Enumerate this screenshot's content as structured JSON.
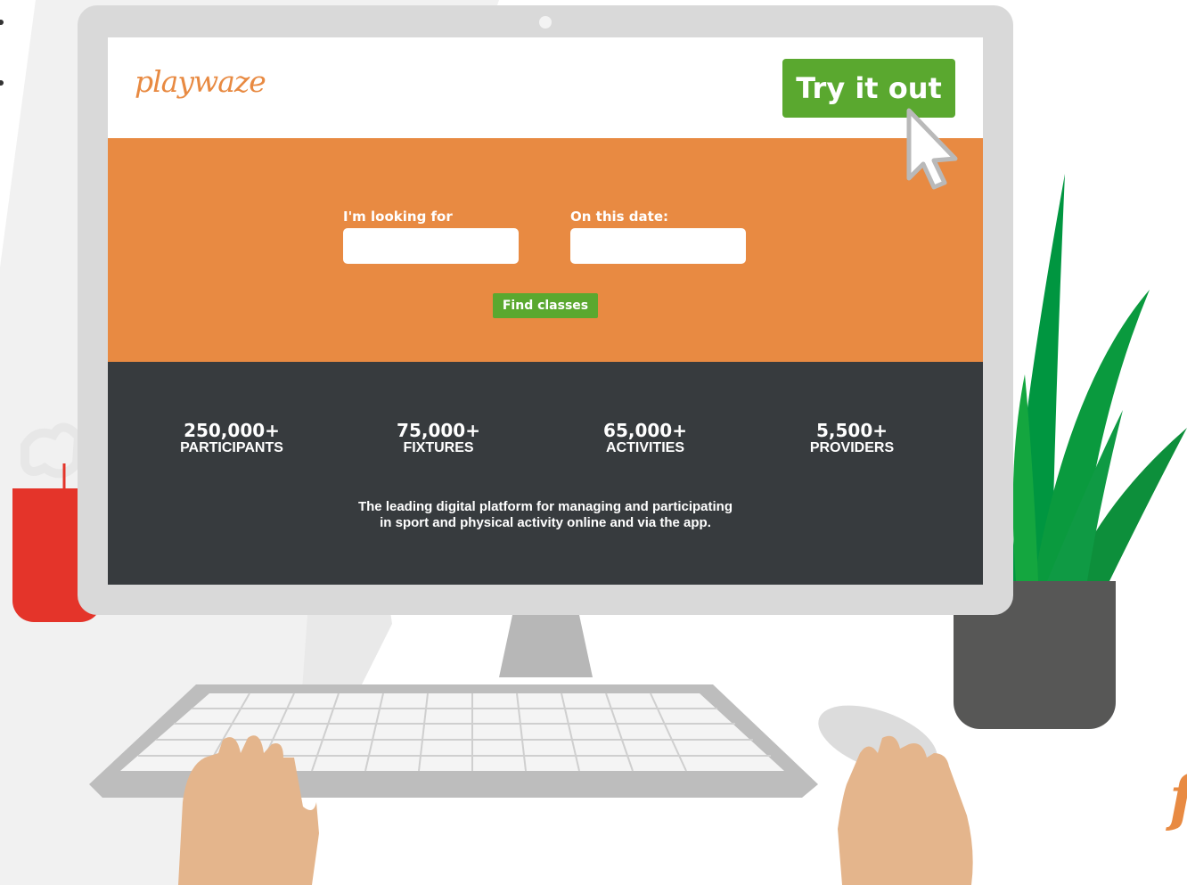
{
  "brand": {
    "logo": "playwaze",
    "accent_orange": "#e88a42",
    "accent_green": "#5aa82f",
    "dark_band": "#373b3e"
  },
  "header": {
    "cta_label": "Try it out"
  },
  "search": {
    "looking_for_label": "I'm looking for",
    "looking_for_value": "",
    "date_label": "On this date:",
    "date_value": "",
    "submit_label": "Find classes"
  },
  "stats": [
    {
      "value": "250,000+",
      "label": "PARTICIPANTS"
    },
    {
      "value": "75,000+",
      "label": "FIXTURES"
    },
    {
      "value": "65,000+",
      "label": "ACTIVITIES"
    },
    {
      "value": "5,500+",
      "label": "PROVIDERS"
    }
  ],
  "tagline": {
    "line1": "The leading digital platform for managing and participating",
    "line2": "in sport and physical activity online and via the app."
  },
  "icons": {
    "cursor": "mouse-pointer-icon",
    "plant": "potted-plant-illustration",
    "mug": "mug-illustration",
    "keyboard": "keyboard-illustration",
    "mouse": "computer-mouse-illustration"
  }
}
